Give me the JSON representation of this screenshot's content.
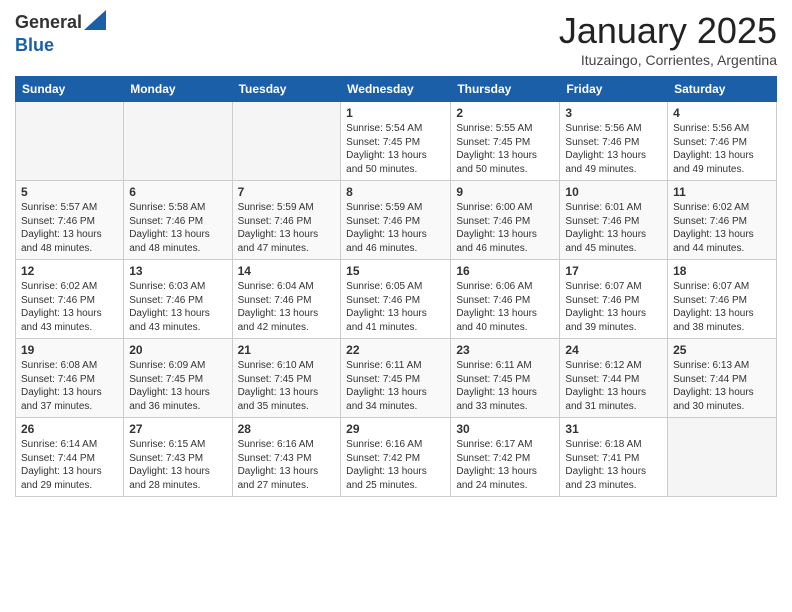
{
  "logo": {
    "general": "General",
    "blue": "Blue"
  },
  "header": {
    "month": "January 2025",
    "location": "Ituzaingo, Corrientes, Argentina"
  },
  "days_of_week": [
    "Sunday",
    "Monday",
    "Tuesday",
    "Wednesday",
    "Thursday",
    "Friday",
    "Saturday"
  ],
  "weeks": [
    [
      {
        "day": "",
        "info": ""
      },
      {
        "day": "",
        "info": ""
      },
      {
        "day": "",
        "info": ""
      },
      {
        "day": "1",
        "info": "Sunrise: 5:54 AM\nSunset: 7:45 PM\nDaylight: 13 hours\nand 50 minutes."
      },
      {
        "day": "2",
        "info": "Sunrise: 5:55 AM\nSunset: 7:45 PM\nDaylight: 13 hours\nand 50 minutes."
      },
      {
        "day": "3",
        "info": "Sunrise: 5:56 AM\nSunset: 7:46 PM\nDaylight: 13 hours\nand 49 minutes."
      },
      {
        "day": "4",
        "info": "Sunrise: 5:56 AM\nSunset: 7:46 PM\nDaylight: 13 hours\nand 49 minutes."
      }
    ],
    [
      {
        "day": "5",
        "info": "Sunrise: 5:57 AM\nSunset: 7:46 PM\nDaylight: 13 hours\nand 48 minutes."
      },
      {
        "day": "6",
        "info": "Sunrise: 5:58 AM\nSunset: 7:46 PM\nDaylight: 13 hours\nand 48 minutes."
      },
      {
        "day": "7",
        "info": "Sunrise: 5:59 AM\nSunset: 7:46 PM\nDaylight: 13 hours\nand 47 minutes."
      },
      {
        "day": "8",
        "info": "Sunrise: 5:59 AM\nSunset: 7:46 PM\nDaylight: 13 hours\nand 46 minutes."
      },
      {
        "day": "9",
        "info": "Sunrise: 6:00 AM\nSunset: 7:46 PM\nDaylight: 13 hours\nand 46 minutes."
      },
      {
        "day": "10",
        "info": "Sunrise: 6:01 AM\nSunset: 7:46 PM\nDaylight: 13 hours\nand 45 minutes."
      },
      {
        "day": "11",
        "info": "Sunrise: 6:02 AM\nSunset: 7:46 PM\nDaylight: 13 hours\nand 44 minutes."
      }
    ],
    [
      {
        "day": "12",
        "info": "Sunrise: 6:02 AM\nSunset: 7:46 PM\nDaylight: 13 hours\nand 43 minutes."
      },
      {
        "day": "13",
        "info": "Sunrise: 6:03 AM\nSunset: 7:46 PM\nDaylight: 13 hours\nand 43 minutes."
      },
      {
        "day": "14",
        "info": "Sunrise: 6:04 AM\nSunset: 7:46 PM\nDaylight: 13 hours\nand 42 minutes."
      },
      {
        "day": "15",
        "info": "Sunrise: 6:05 AM\nSunset: 7:46 PM\nDaylight: 13 hours\nand 41 minutes."
      },
      {
        "day": "16",
        "info": "Sunrise: 6:06 AM\nSunset: 7:46 PM\nDaylight: 13 hours\nand 40 minutes."
      },
      {
        "day": "17",
        "info": "Sunrise: 6:07 AM\nSunset: 7:46 PM\nDaylight: 13 hours\nand 39 minutes."
      },
      {
        "day": "18",
        "info": "Sunrise: 6:07 AM\nSunset: 7:46 PM\nDaylight: 13 hours\nand 38 minutes."
      }
    ],
    [
      {
        "day": "19",
        "info": "Sunrise: 6:08 AM\nSunset: 7:46 PM\nDaylight: 13 hours\nand 37 minutes."
      },
      {
        "day": "20",
        "info": "Sunrise: 6:09 AM\nSunset: 7:45 PM\nDaylight: 13 hours\nand 36 minutes."
      },
      {
        "day": "21",
        "info": "Sunrise: 6:10 AM\nSunset: 7:45 PM\nDaylight: 13 hours\nand 35 minutes."
      },
      {
        "day": "22",
        "info": "Sunrise: 6:11 AM\nSunset: 7:45 PM\nDaylight: 13 hours\nand 34 minutes."
      },
      {
        "day": "23",
        "info": "Sunrise: 6:11 AM\nSunset: 7:45 PM\nDaylight: 13 hours\nand 33 minutes."
      },
      {
        "day": "24",
        "info": "Sunrise: 6:12 AM\nSunset: 7:44 PM\nDaylight: 13 hours\nand 31 minutes."
      },
      {
        "day": "25",
        "info": "Sunrise: 6:13 AM\nSunset: 7:44 PM\nDaylight: 13 hours\nand 30 minutes."
      }
    ],
    [
      {
        "day": "26",
        "info": "Sunrise: 6:14 AM\nSunset: 7:44 PM\nDaylight: 13 hours\nand 29 minutes."
      },
      {
        "day": "27",
        "info": "Sunrise: 6:15 AM\nSunset: 7:43 PM\nDaylight: 13 hours\nand 28 minutes."
      },
      {
        "day": "28",
        "info": "Sunrise: 6:16 AM\nSunset: 7:43 PM\nDaylight: 13 hours\nand 27 minutes."
      },
      {
        "day": "29",
        "info": "Sunrise: 6:16 AM\nSunset: 7:42 PM\nDaylight: 13 hours\nand 25 minutes."
      },
      {
        "day": "30",
        "info": "Sunrise: 6:17 AM\nSunset: 7:42 PM\nDaylight: 13 hours\nand 24 minutes."
      },
      {
        "day": "31",
        "info": "Sunrise: 6:18 AM\nSunset: 7:41 PM\nDaylight: 13 hours\nand 23 minutes."
      },
      {
        "day": "",
        "info": ""
      }
    ]
  ]
}
